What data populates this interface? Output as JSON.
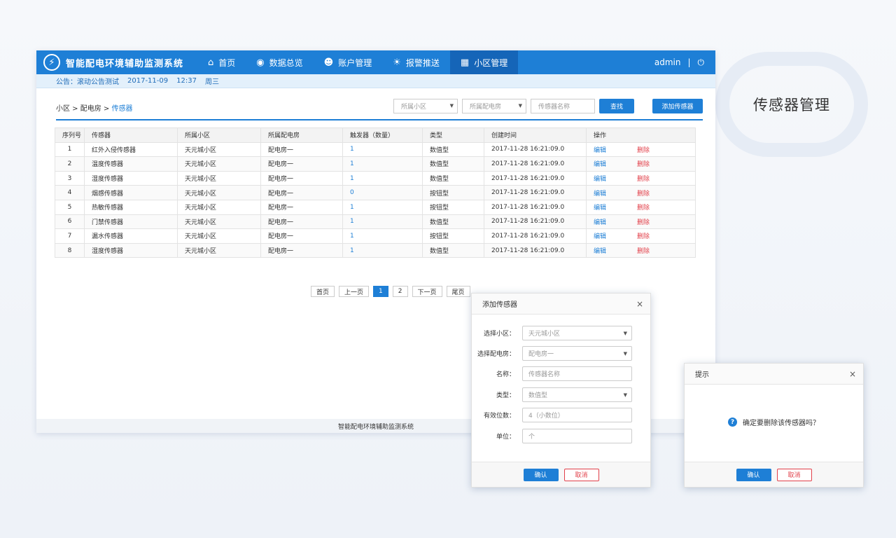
{
  "side_label": "传感器管理",
  "app": {
    "title": "智能配电环境辅助监测系统",
    "nav": [
      {
        "label": "首页",
        "icon": "home-icon"
      },
      {
        "label": "数据总览",
        "icon": "dashboard-icon"
      },
      {
        "label": "账户管理",
        "icon": "user-icon"
      },
      {
        "label": "报警推送",
        "icon": "alarm-icon"
      },
      {
        "label": "小区管理",
        "icon": "grid-icon"
      }
    ],
    "user": "admin",
    "notice": {
      "prefix": "公告：",
      "text": "滚动公告测试",
      "date": "2017-11-09",
      "time": "12:37",
      "weekday": "周三"
    },
    "breadcrumb": {
      "a": "小区",
      "b": "配电房",
      "c": "传感器",
      "sep": " > "
    },
    "filters": {
      "community": "所属小区",
      "room": "所属配电房",
      "name_placeholder": "传感器名称",
      "search": "查找",
      "add": "添加传感器"
    },
    "footer": "智能配电环境辅助监测系统"
  },
  "table": {
    "headers": [
      "序列号",
      "传感器",
      "所属小区",
      "所属配电房",
      "触发器（数量）",
      "类型",
      "创建时间",
      "操作"
    ],
    "rows": [
      {
        "no": "1",
        "sensor": "红外入侵传感器",
        "community": "天元城小区",
        "room": "配电房一",
        "count": "1",
        "type": "数值型",
        "created": "2017-11-28 16:21:09.0",
        "edit": "编辑",
        "del": "删除"
      },
      {
        "no": "2",
        "sensor": "温度传感器",
        "community": "天元城小区",
        "room": "配电房一",
        "count": "1",
        "type": "数值型",
        "created": "2017-11-28 16:21:09.0",
        "edit": "编辑",
        "del": "删除"
      },
      {
        "no": "3",
        "sensor": "湿度传感器",
        "community": "天元城小区",
        "room": "配电房一",
        "count": "1",
        "type": "数值型",
        "created": "2017-11-28 16:21:09.0",
        "edit": "编辑",
        "del": "删除"
      },
      {
        "no": "4",
        "sensor": "烟感传感器",
        "community": "天元城小区",
        "room": "配电房一",
        "count": "0",
        "type": "按钮型",
        "created": "2017-11-28 16:21:09.0",
        "edit": "编辑",
        "del": "删除"
      },
      {
        "no": "5",
        "sensor": "热敏传感器",
        "community": "天元城小区",
        "room": "配电房一",
        "count": "1",
        "type": "按钮型",
        "created": "2017-11-28 16:21:09.0",
        "edit": "编辑",
        "del": "删除"
      },
      {
        "no": "6",
        "sensor": "门禁传感器",
        "community": "天元城小区",
        "room": "配电房一",
        "count": "1",
        "type": "数值型",
        "created": "2017-11-28 16:21:09.0",
        "edit": "编辑",
        "del": "删除"
      },
      {
        "no": "7",
        "sensor": "漏水传感器",
        "community": "天元城小区",
        "room": "配电房一",
        "count": "1",
        "type": "按钮型",
        "created": "2017-11-28 16:21:09.0",
        "edit": "编辑",
        "del": "删除"
      },
      {
        "no": "8",
        "sensor": "湿度传感器",
        "community": "天元城小区",
        "room": "配电房一",
        "count": "1",
        "type": "数值型",
        "created": "2017-11-28 16:21:09.0",
        "edit": "编辑",
        "del": "删除"
      }
    ]
  },
  "pager": {
    "first": "首页",
    "prev": "上一页",
    "p1": "1",
    "p2": "2",
    "next": "下一页",
    "last": "尾页"
  },
  "add_dialog": {
    "title": "添加传感器",
    "close": "×",
    "fields": [
      {
        "label": "选择小区：",
        "value": "天元城小区"
      },
      {
        "label": "选择配电房：",
        "value": "配电房一"
      },
      {
        "label": "名称：",
        "value": "传感器名称"
      },
      {
        "label": "类型：",
        "value": "数值型"
      },
      {
        "label": "有效位数：",
        "value": "4（小数位）"
      },
      {
        "label": "单位：",
        "value": "个"
      }
    ],
    "ok": "确认",
    "cancel": "取消"
  },
  "confirm_dialog": {
    "title": "提示",
    "close": "×",
    "message": "确定要删除该传感器吗？",
    "ok": "确认",
    "cancel": "取消"
  }
}
